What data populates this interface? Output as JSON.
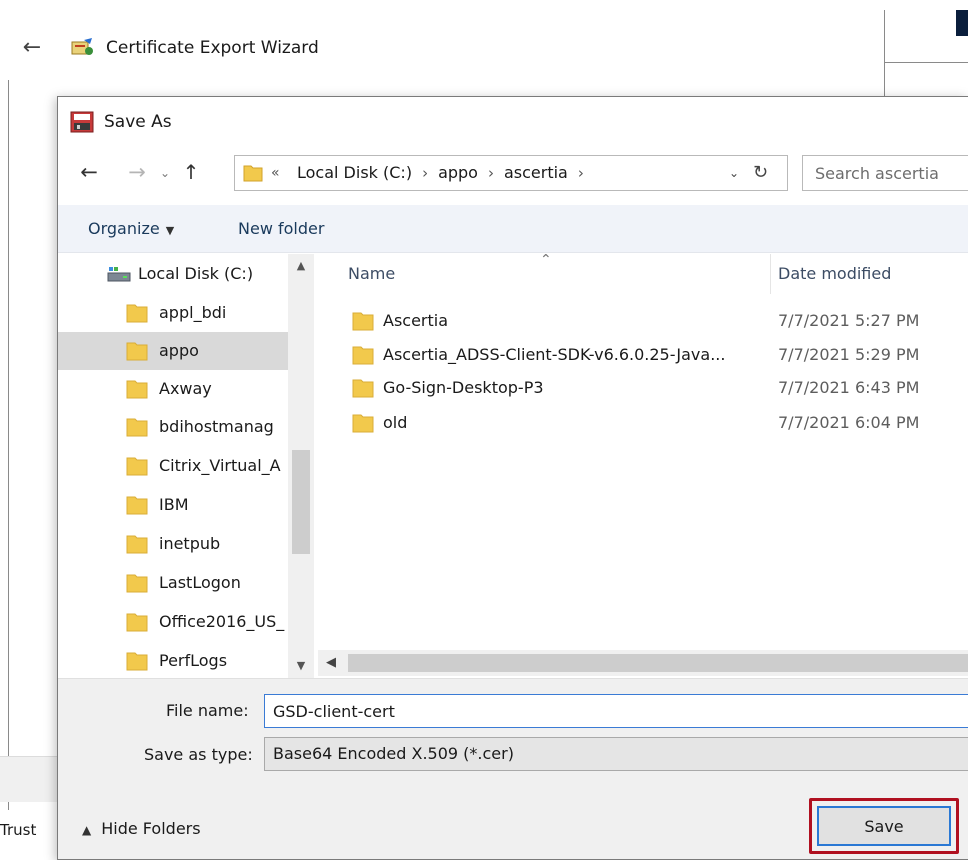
{
  "wizard": {
    "title": "Certificate Export Wizard",
    "bottom_text": "Trust"
  },
  "dialog": {
    "title": "Save As",
    "address": {
      "overflow": "«",
      "crumbs": [
        "Local Disk (C:)",
        "appo",
        "ascertia"
      ]
    },
    "search": {
      "placeholder": "Search ascertia"
    },
    "toolbar": {
      "organize_label": "Organize",
      "new_folder_label": "New folder"
    },
    "nav_pane": {
      "root_label": "Local Disk (C:)",
      "items": [
        {
          "label": "appl_bdi",
          "selected": false
        },
        {
          "label": "appo",
          "selected": true
        },
        {
          "label": "Axway",
          "selected": false
        },
        {
          "label": "bdihostmanag",
          "selected": false
        },
        {
          "label": "Citrix_Virtual_A",
          "selected": false
        },
        {
          "label": "IBM",
          "selected": false
        },
        {
          "label": "inetpub",
          "selected": false
        },
        {
          "label": "LastLogon",
          "selected": false
        },
        {
          "label": "Office2016_US_",
          "selected": false
        },
        {
          "label": "PerfLogs",
          "selected": false
        }
      ]
    },
    "file_list": {
      "columns": {
        "name": "Name",
        "date_modified": "Date modified"
      },
      "rows": [
        {
          "name": "Ascertia",
          "date": "7/7/2021 5:27 PM"
        },
        {
          "name": "Ascertia_ADSS-Client-SDK-v6.6.0.25-Java...",
          "date": "7/7/2021 5:29 PM"
        },
        {
          "name": "Go-Sign-Desktop-P3",
          "date": "7/7/2021 6:43 PM"
        },
        {
          "name": "old",
          "date": "7/7/2021 6:04 PM"
        }
      ]
    },
    "file_name": {
      "label": "File name:",
      "value": "GSD-client-cert"
    },
    "save_as_type": {
      "label": "Save as type:",
      "value": "Base64 Encoded X.509 (*.cer)"
    },
    "hide_folders_label": "Hide Folders",
    "save_label": "Save"
  },
  "colors": {
    "highlight": "#b01020",
    "focus_border": "#2a78d4",
    "folder_yellow": "#f2c94c",
    "selected_row": "#d9d9d9"
  }
}
